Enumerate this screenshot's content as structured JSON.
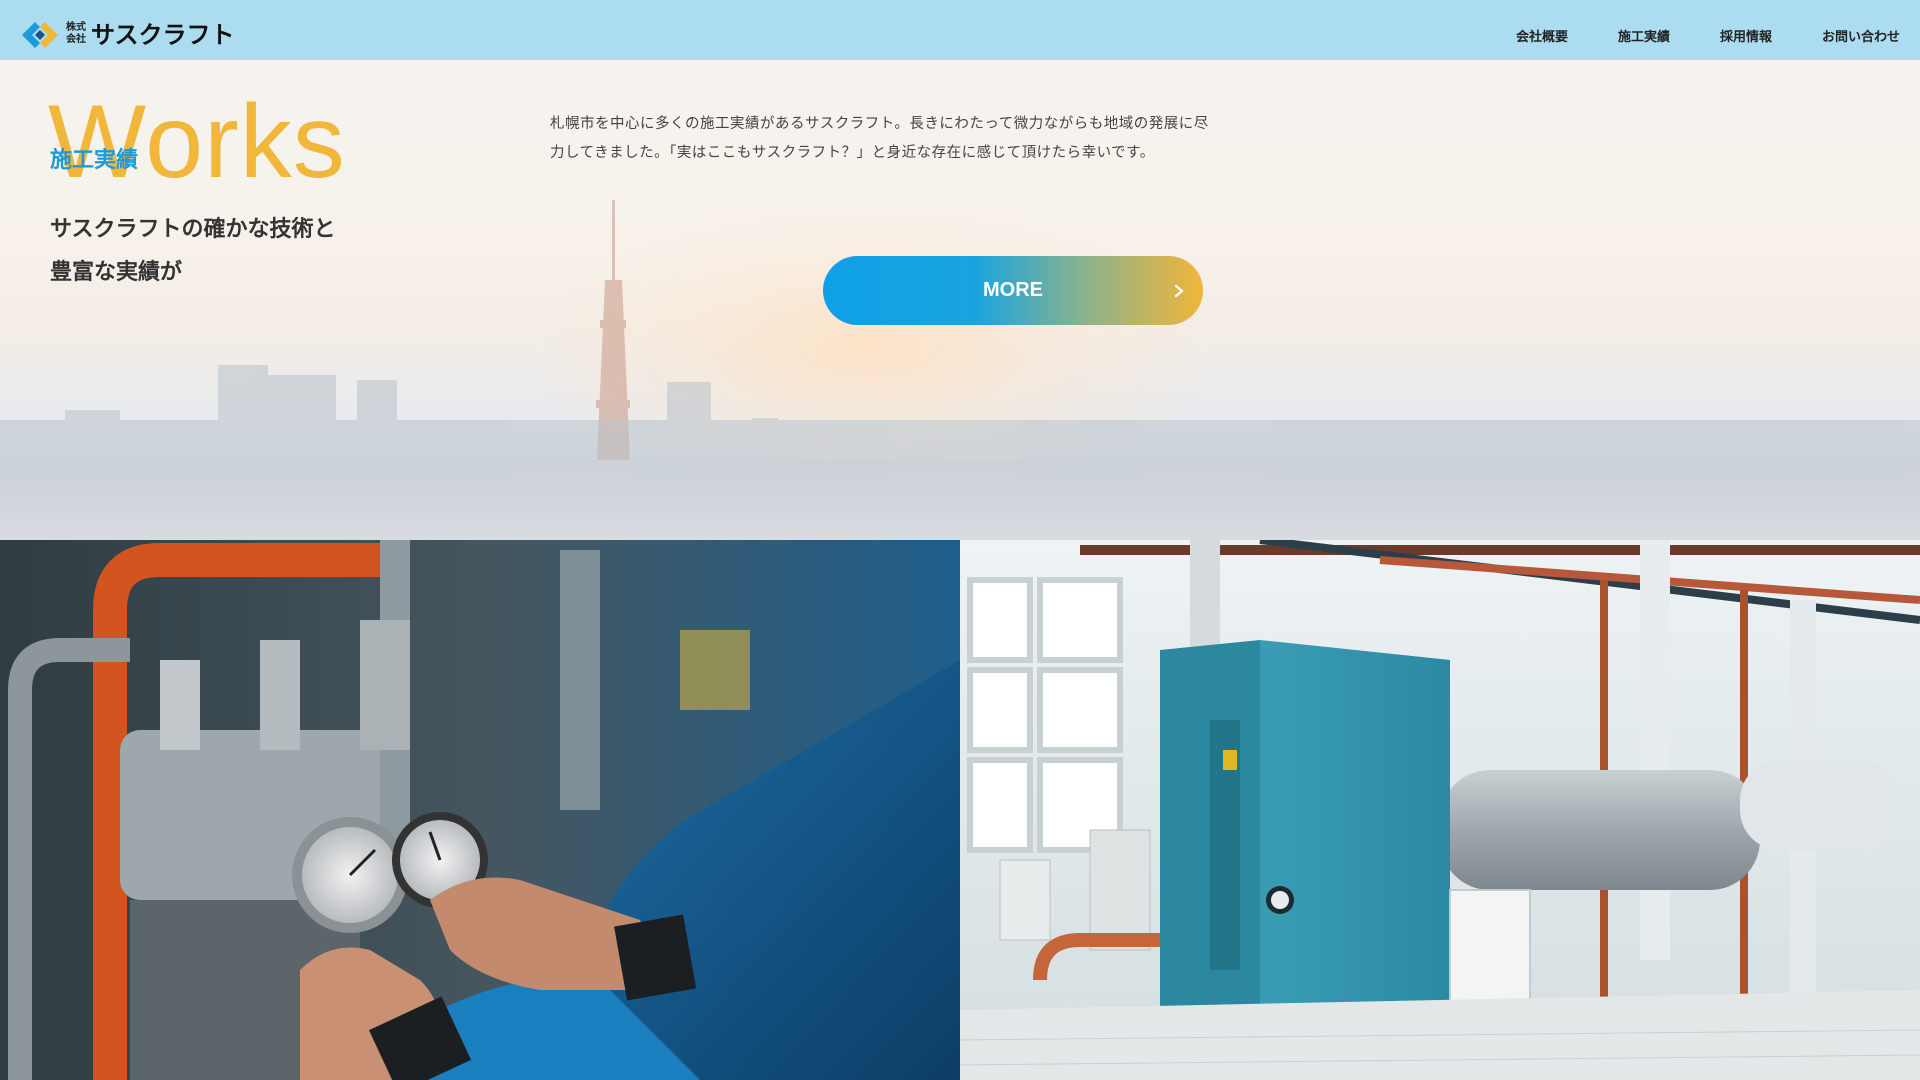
{
  "header": {
    "logo_small": "株式会社",
    "logo_name": "サスクラフト",
    "nav": [
      {
        "label": "会社概要"
      },
      {
        "label": "施工実績"
      },
      {
        "label": "採用情報"
      },
      {
        "label": "お問い合わせ"
      }
    ]
  },
  "works": {
    "heading_en": "Works",
    "heading_jp": "施工実績",
    "lead_line1": "サスクラフトの確かな技術と",
    "lead_line2": "豊富な実績が",
    "description": "札幌市を中心に多くの施工実績があるサスクラフト。長きにわたって微力ながらも地域の発展に尽力してきました。「実はここもサスクラフト？」と身近な存在に感じて頂けたら幸いです。",
    "more_label": "MORE"
  },
  "colors": {
    "header_bg": "#acdcf0",
    "accent_yellow": "#f0b73a",
    "accent_blue": "#1f9ad8"
  },
  "images": {
    "left_photo": "technician-adjusting-pressure-gauge",
    "right_photo": "boiler-room-with-teal-equipment"
  }
}
